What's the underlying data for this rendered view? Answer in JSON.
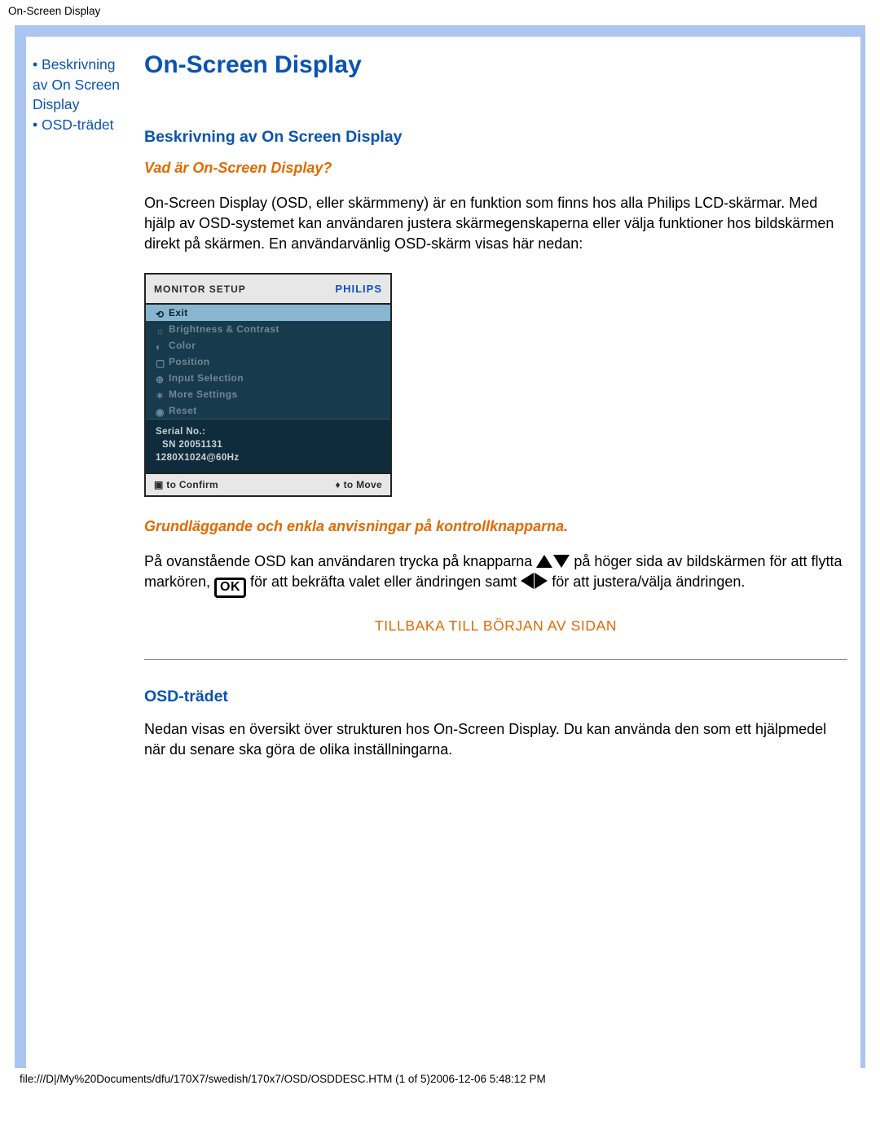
{
  "header": {
    "title": "On-Screen Display"
  },
  "sidebar": {
    "items": [
      {
        "label": "Beskrivning av On Screen Display"
      },
      {
        "label": "OSD-trädet"
      }
    ]
  },
  "main": {
    "title": "On-Screen Display",
    "section1_heading": "Beskrivning av On Screen Display",
    "q1": "Vad är On-Screen Display?",
    "p1": "On-Screen Display (OSD, eller skärmmeny) är en funktion som finns hos alla Philips LCD-skärmar. Med hjälp av OSD-systemet kan användaren justera skärmegenskaperna eller välja funktioner hos bildskärmen direkt på skärmen. En användarvänlig OSD-skärm visas här nedan:",
    "q2": "Grundläggande och enkla anvisningar på kontrollknapparna.",
    "p2_a": "På ovanstående OSD kan användaren trycka på knapparna ",
    "p2_b": " på höger sida av bildskärmen för att flytta markören, ",
    "p2_c": " för att bekräfta valet eller ändringen samt ",
    "p2_d": " för att justera/välja ändringen.",
    "back_to_top": "TILLBAKA TILL BÖRJAN AV SIDAN",
    "section2_heading": "OSD-trädet",
    "p3": "Nedan visas en översikt över strukturen hos On-Screen Display. Du kan använda den som ett hjälpmedel när du senare ska göra de olika inställningarna."
  },
  "osd": {
    "title": "MONITOR SETUP",
    "brand": "PHILIPS",
    "menu": [
      "Exit",
      "Brightness & Contrast",
      "Color",
      "Position",
      "Input Selection",
      "More Settings",
      "Reset"
    ],
    "serial_label": "Serial No.:",
    "serial_value": "SN 20051131",
    "mode": "1280X1024@60Hz",
    "confirm_hint": "to Confirm",
    "move_hint": "to Move",
    "ok_label": "OK"
  },
  "icons": {
    "ok_label": "OK"
  },
  "footer": {
    "path": "file:///D|/My%20Documents/dfu/170X7/swedish/170x7/OSD/OSDDESC.HTM (1 of 5)2006-12-06 5:48:12 PM"
  }
}
